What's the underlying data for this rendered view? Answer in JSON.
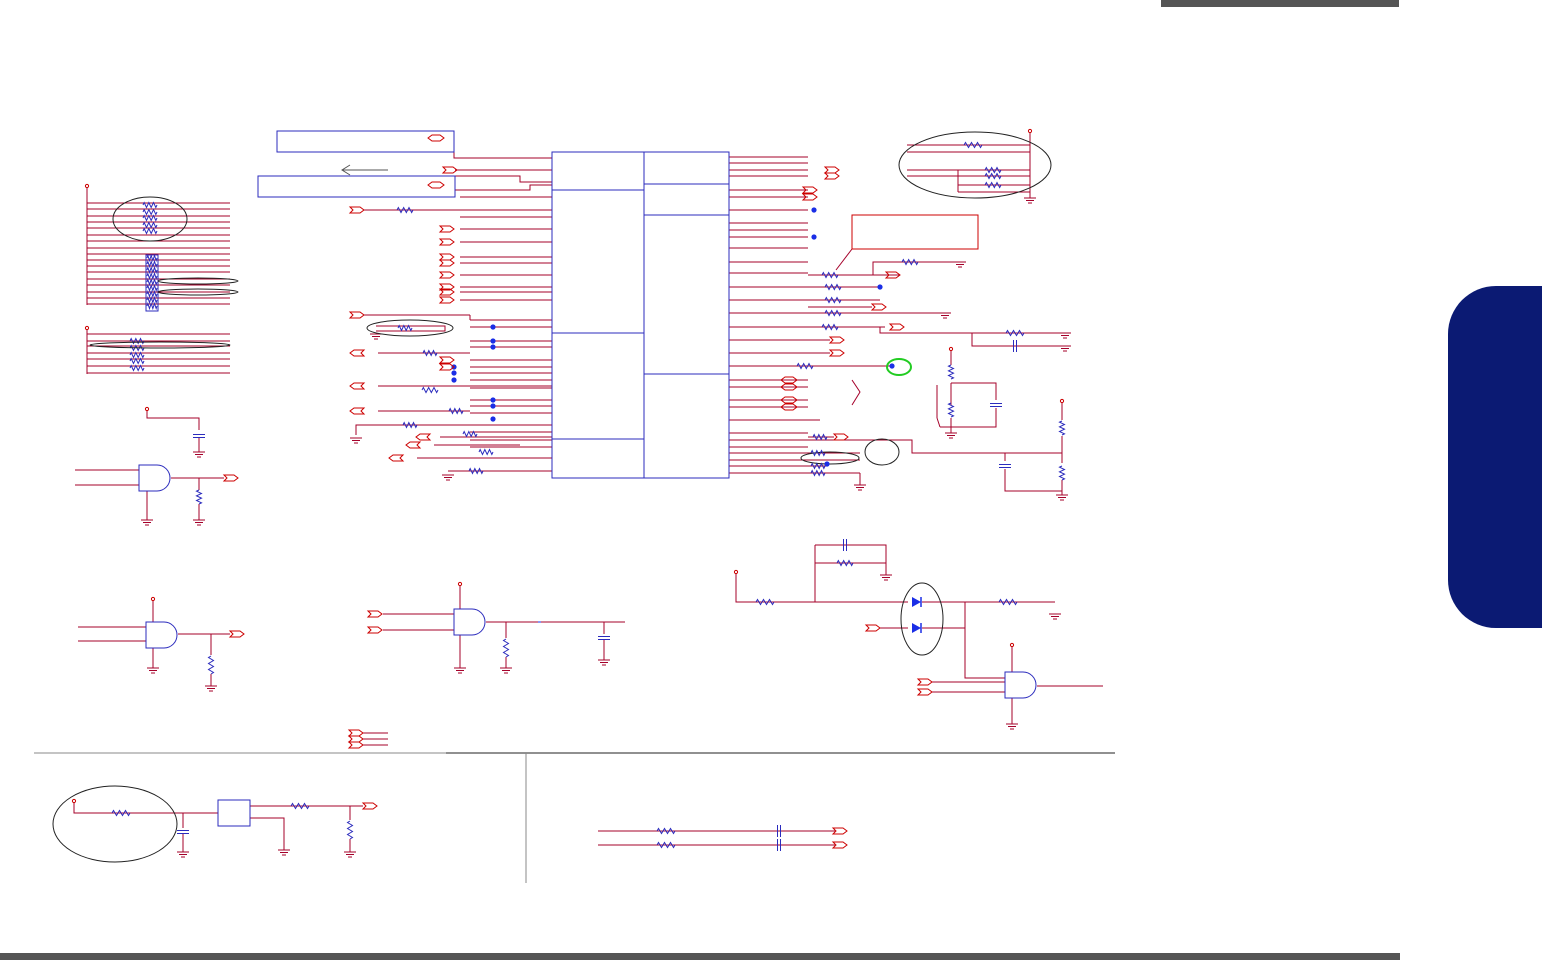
{
  "colors": {
    "wire": "#a5002a",
    "part": "#2b2bbd",
    "pin": "#cc0000",
    "node": "#1a2ee6",
    "highlight": "#22cc22",
    "divider": "#888888",
    "bar": "#555555",
    "tab": "#0b1a73"
  },
  "icons": {
    "gate": "and-gate-icon",
    "diode": "diode-icon",
    "resistor": "resistor-icon",
    "capacitor": "capacitor-icon",
    "ground": "ground-icon",
    "connector": "offpage-connector-icon",
    "junction": "junction-dot-icon"
  },
  "text": {}
}
